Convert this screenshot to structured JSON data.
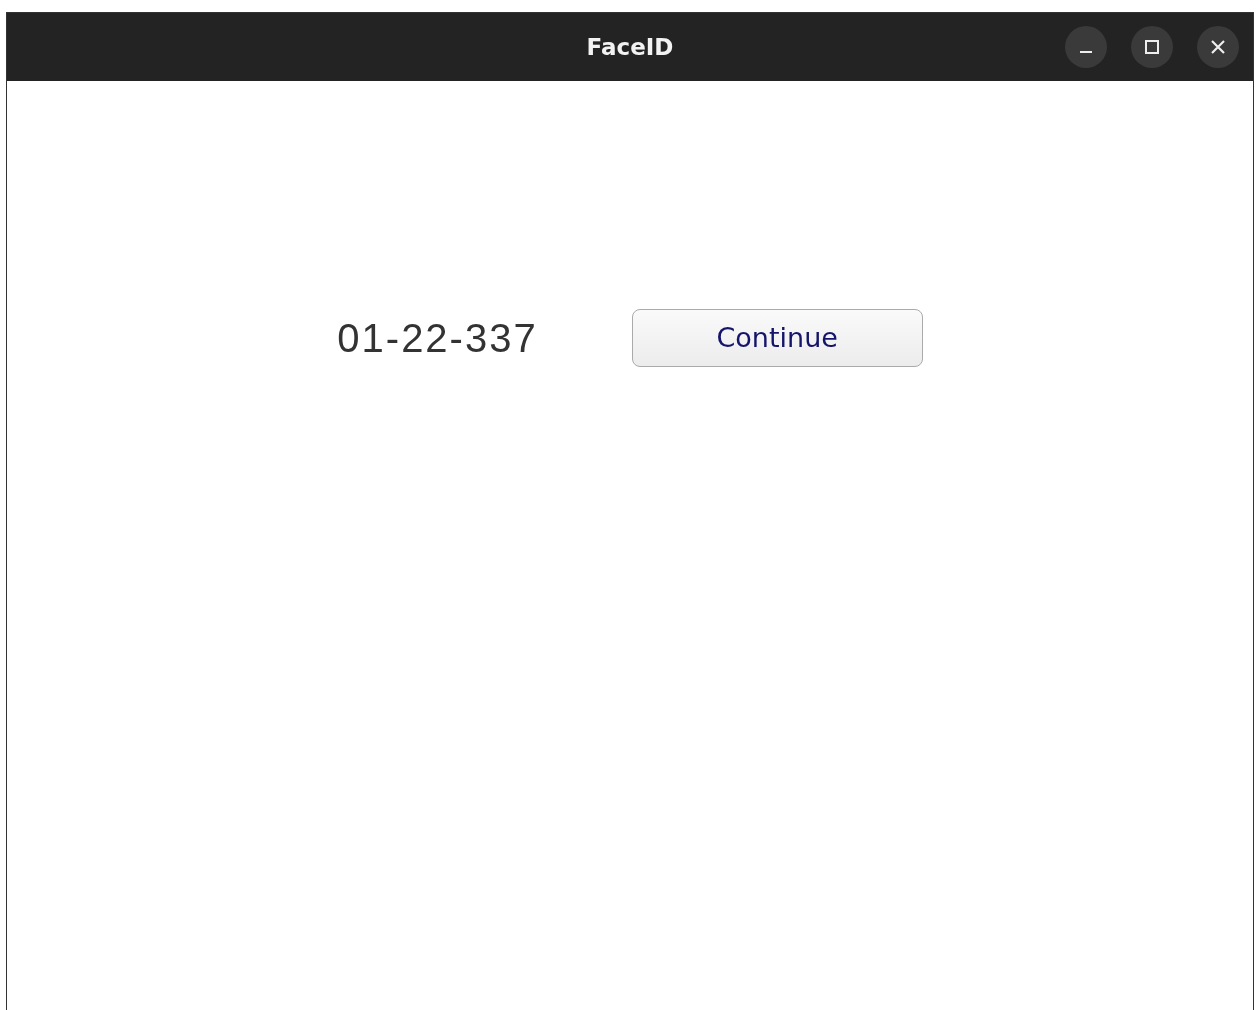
{
  "window": {
    "title": "FaceID"
  },
  "code_label": "01-22-337",
  "button": {
    "label": "Continue"
  }
}
